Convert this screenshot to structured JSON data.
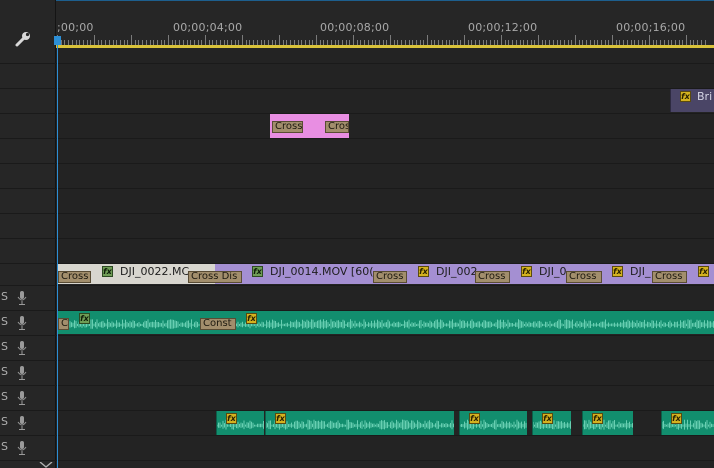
{
  "ruler": {
    "ticks": [
      ";00;00",
      "00;00;04;00",
      "00;00;08;00",
      "00;00;12;00",
      "00;00;16;00"
    ]
  },
  "video_clips": {
    "v3_clip_label": "Bri",
    "v2_trans_left": "Cross",
    "v2_trans_right": "Cross",
    "v1": {
      "trans_start": "Cross",
      "clip1_name": "DJI_0022.MC",
      "trans_1": "Cross Dis",
      "clip2_name": "DJI_0014.MOV [60(",
      "trans_2": "Cross",
      "clip3_name": "DJI_002",
      "trans_3": "Cross",
      "clip4_name": "DJI_0",
      "trans_4": "Cross",
      "clip5_name": "DJI_",
      "trans_5": "Cross"
    }
  },
  "audio": {
    "track_letter": "S",
    "a2_trans_start": "C",
    "a2_trans_mid": "Const"
  },
  "fx_label": "fx",
  "colors": {
    "playhead": "#2c8fd6",
    "audio_clip": "#128e6e",
    "pink_clip": "#e88ee2",
    "purple_clip": "#a48fd2",
    "grey_clip": "#d8d6cf",
    "transition": "#a28e6c",
    "fx_badge": "#d4b21f"
  }
}
